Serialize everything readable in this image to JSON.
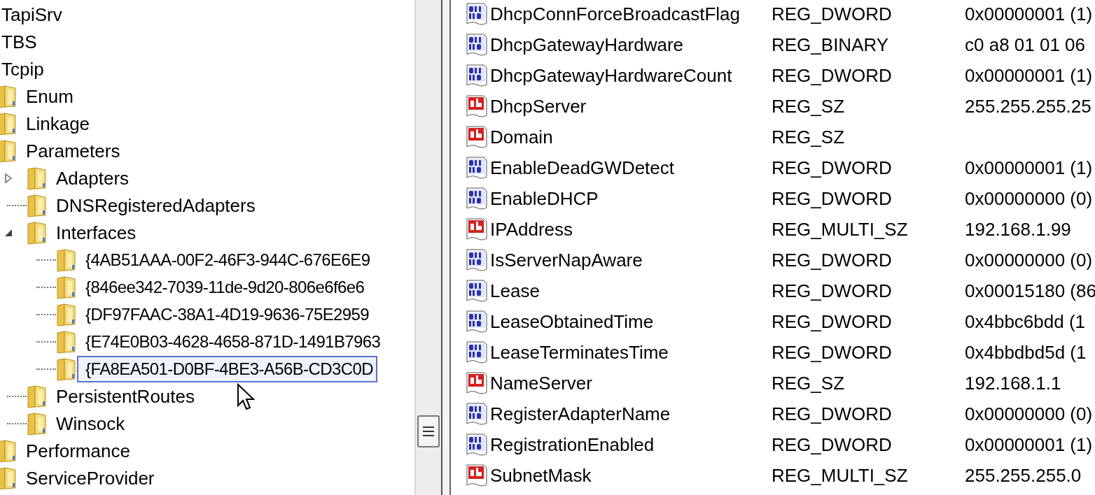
{
  "tree": [
    {
      "label": "TapiSrv",
      "selected": false
    },
    {
      "label": "TBS",
      "selected": false
    },
    {
      "label": "Tcpip",
      "selected": false,
      "children": [
        {
          "label": "Enum",
          "selected": false
        },
        {
          "label": "Linkage",
          "selected": false
        },
        {
          "label": "Parameters",
          "selected": false,
          "children": [
            {
              "label": "Adapters",
              "selected": false,
              "expanded": false
            },
            {
              "label": "DNSRegisteredAdapters",
              "selected": false
            },
            {
              "label": "Interfaces",
              "selected": false,
              "expanded": true,
              "children": [
                {
                  "label": "{4AB51AAA-00F2-46F3-944C-676E6E9",
                  "selected": false
                },
                {
                  "label": "{846ee342-7039-11de-9d20-806e6f6e6",
                  "selected": false
                },
                {
                  "label": "{DF97FAAC-38A1-4D19-9636-75E2959",
                  "selected": false
                },
                {
                  "label": "{E74E0B03-4628-4658-871D-1491B7963",
                  "selected": false
                },
                {
                  "label": "{FA8EA501-D0BF-4BE3-A56B-CD3C0D",
                  "selected": true
                }
              ]
            },
            {
              "label": "PersistentRoutes",
              "selected": false
            },
            {
              "label": "Winsock",
              "selected": false
            }
          ]
        },
        {
          "label": "Performance",
          "selected": false
        },
        {
          "label": "ServiceProvider",
          "selected": false
        }
      ]
    }
  ],
  "values": [
    {
      "kind": "binary",
      "name": "DhcpConnForceBroadcastFlag",
      "type": "REG_DWORD",
      "data": "0x00000001 (1)"
    },
    {
      "kind": "binary",
      "name": "DhcpGatewayHardware",
      "type": "REG_BINARY",
      "data": "c0 a8 01 01 06"
    },
    {
      "kind": "binary",
      "name": "DhcpGatewayHardwareCount",
      "type": "REG_DWORD",
      "data": "0x00000001 (1)"
    },
    {
      "kind": "string",
      "name": "DhcpServer",
      "type": "REG_SZ",
      "data": "255.255.255.25"
    },
    {
      "kind": "string",
      "name": "Domain",
      "type": "REG_SZ"
    },
    {
      "kind": "binary",
      "name": "EnableDeadGWDetect",
      "type": "REG_DWORD",
      "data": "0x00000001 (1)"
    },
    {
      "kind": "binary",
      "name": "EnableDHCP",
      "type": "REG_DWORD",
      "data": "0x00000000 (0)"
    },
    {
      "kind": "string",
      "name": "IPAddress",
      "type": "REG_MULTI_SZ",
      "data": "192.168.1.99"
    },
    {
      "kind": "binary",
      "name": "IsServerNapAware",
      "type": "REG_DWORD",
      "data": "0x00000000 (0)"
    },
    {
      "kind": "binary",
      "name": "Lease",
      "type": "REG_DWORD",
      "data": "0x00015180 (86"
    },
    {
      "kind": "binary",
      "name": "LeaseObtainedTime",
      "type": "REG_DWORD",
      "data": "0x4bbc6bdd (1"
    },
    {
      "kind": "binary",
      "name": "LeaseTerminatesTime",
      "type": "REG_DWORD",
      "data": "0x4bbdbd5d (1"
    },
    {
      "kind": "string",
      "name": "NameServer",
      "type": "REG_SZ",
      "data": "192.168.1.1"
    },
    {
      "kind": "binary",
      "name": "RegisterAdapterName",
      "type": "REG_DWORD",
      "data": "0x00000000 (0)"
    },
    {
      "kind": "binary",
      "name": "RegistrationEnabled",
      "type": "REG_DWORD",
      "data": "0x00000001 (1)"
    },
    {
      "kind": "string",
      "name": "SubnetMask",
      "type": "REG_MULTI_SZ",
      "data": "255.255.255.0"
    }
  ]
}
